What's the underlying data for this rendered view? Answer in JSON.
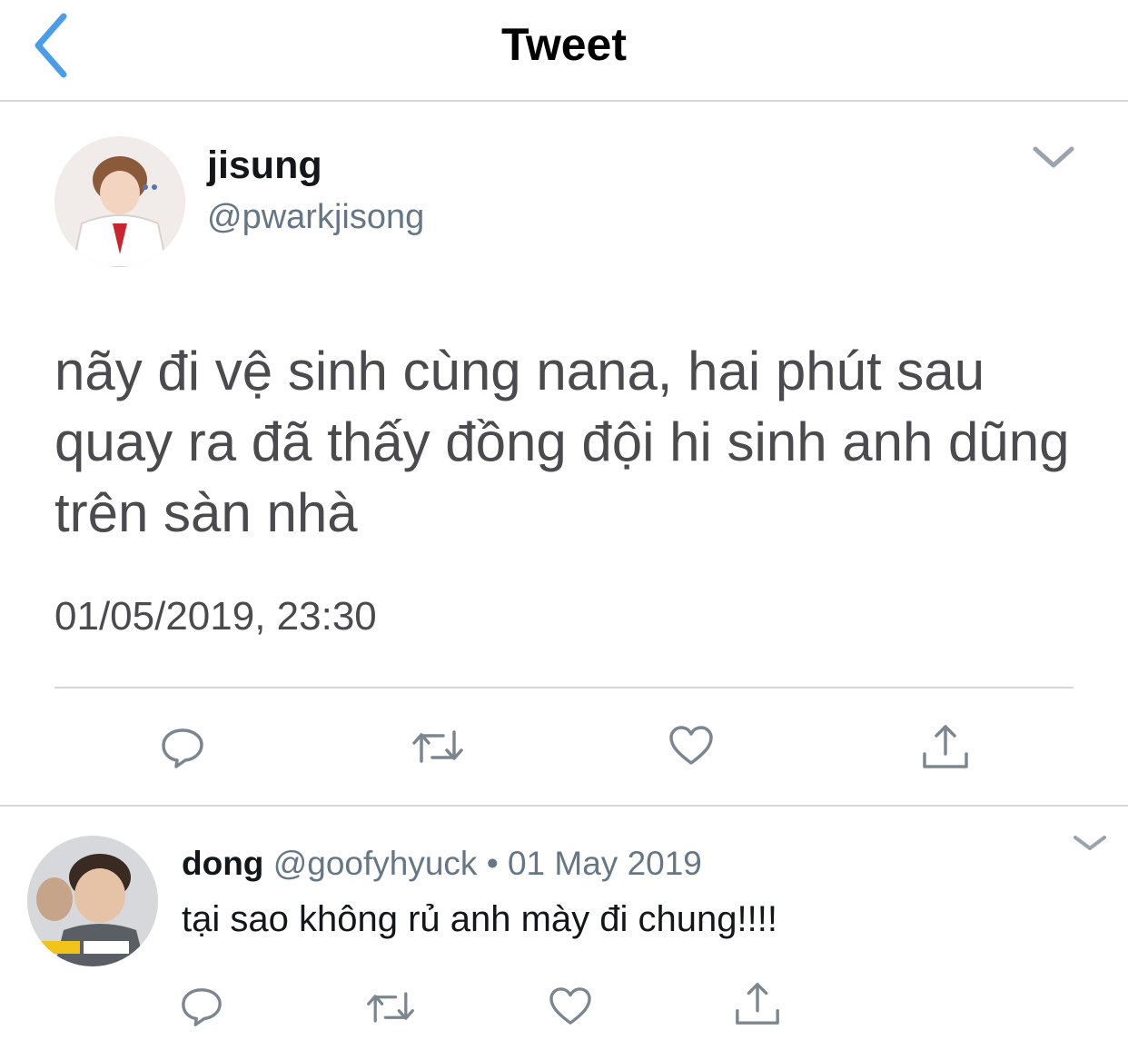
{
  "header": {
    "title": "Tweet",
    "back_icon": "chevron-left-icon",
    "accent_color": "#4a9de8"
  },
  "main_tweet": {
    "name": "jisung",
    "handle": "@pwarkjisong",
    "text": "nãy đi vệ sinh cùng nana, hai phút sau quay ra đã thấy đồng đội hi sinh anh dũng trên sàn nhà",
    "timestamp": "01/05/2019, 23:30",
    "menu_icon": "chevron-down-icon",
    "actions": [
      "reply-icon",
      "retweet-icon",
      "like-icon",
      "share-icon"
    ]
  },
  "reply": {
    "name": "dong",
    "handle": "@goofyhyuck",
    "separator": "•",
    "date": "01 May 2019",
    "text": "tại sao không rủ anh mày đi chung!!!!",
    "menu_icon": "chevron-down-icon",
    "actions": [
      "reply-icon",
      "retweet-icon",
      "like-icon",
      "share-icon"
    ]
  },
  "colors": {
    "primary_text": "#14171a",
    "secondary_text": "#657786",
    "body_text": "#4a4a4f",
    "divider": "#d6d6da",
    "icon_gray": "#7b8691"
  }
}
